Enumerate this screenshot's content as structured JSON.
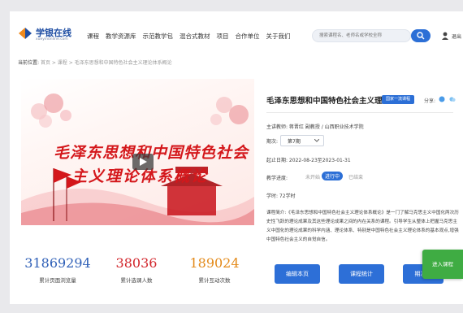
{
  "header": {
    "logo_name": "学银在线",
    "logo_url": "xueyinonline.com",
    "nav": [
      "课程",
      "教学资源库",
      "示范教学包",
      "混合式教材",
      "项目",
      "合作单位",
      "关于我们"
    ],
    "search_placeholder": "搜索课程名、老师名或学校全称",
    "user_label": "退出"
  },
  "breadcrumb": {
    "label": "当前位置:",
    "path": "首页 > 课程 > 毛泽东思想和中国特色社会主义理论体系概论"
  },
  "banner": {
    "line1": "毛泽东思想和中国特色社会",
    "line2": "主义理论体系概论"
  },
  "stats": [
    {
      "value": "31869294",
      "label": "累计页面浏览量"
    },
    {
      "value": "38036",
      "label": "累计选课人数"
    },
    {
      "value": "189024",
      "label": "累计互动次数"
    }
  ],
  "course": {
    "title": "毛泽东思想和中国特色社会主义理...",
    "badge": "国家一流课程",
    "share_label": "分享:",
    "teacher": "主讲教师: 蒋晋红 副教授 / 山西职业技术学院",
    "term_label": "期次:",
    "term_value": "第7期",
    "dates": "起止日期: 2022-08-23至2023-01-31",
    "progress_label": "教学进度:",
    "progress_options": [
      "未开始",
      "进行中",
      "已结束"
    ],
    "hours": "学时: 72学时",
    "intro": "课程简介:《毛泽东思想和中国特色社会主义理论体系概论》是一门了解马克思主义中国化两次历史性飞跃的理论成果及其这些理论成果之间的内在关系的课程。引导学生从整体上把握马克思主义中国化的理论成果的科学内涵、理论体系、特别是中国特色社会主义理论体系的基本观点,增强中国特色社会主义的自觉自信。"
  },
  "actions": {
    "edit": "编辑本页",
    "stats": "课程统计",
    "next": "期次管",
    "enter": "进入课程"
  },
  "colors": {
    "brand_blue": "#2c6fd6",
    "banner_red": "#d4171b",
    "stat_blue": "#2e5fb7",
    "stat_red": "#d2262c",
    "stat_orange": "#e38a1a",
    "enter_green": "#3fac43"
  }
}
